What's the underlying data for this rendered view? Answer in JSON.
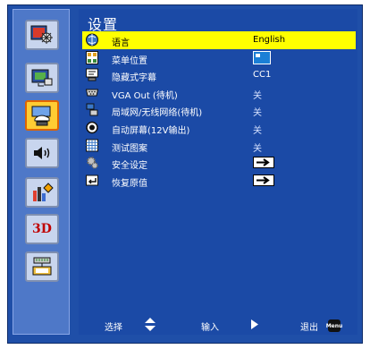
{
  "title": "设置",
  "sidebar": {
    "items": [
      {
        "icon": "image-settings-icon",
        "selected": false
      },
      {
        "icon": "display-screen-icon",
        "selected": false
      },
      {
        "icon": "setup-hand-icon",
        "selected": true
      },
      {
        "icon": "volume-icon",
        "selected": false
      },
      {
        "icon": "options-chart-icon",
        "selected": false
      },
      {
        "icon": "3d-icon",
        "label": "3D",
        "selected": false
      },
      {
        "icon": "network-lan-icon",
        "selected": false
      }
    ]
  },
  "rows": [
    {
      "label": "语言",
      "value": "English",
      "icon": "language-globe-icon",
      "selected": true
    },
    {
      "label": "菜单位置",
      "value": "",
      "icon": "menu-position-icon",
      "control": "position-box"
    },
    {
      "label": "隐藏式字幕",
      "value": "CC1",
      "icon": "closed-caption-icon"
    },
    {
      "label": "VGA Out (待机)",
      "value": "关",
      "icon": "vga-port-icon"
    },
    {
      "label": "局域网/无线网络(待机)",
      "value": "关",
      "icon": "lan-network-icon"
    },
    {
      "label": "自动屏幕(12V输出)",
      "value": "关",
      "icon": "auto-screen-icon"
    },
    {
      "label": "测试图案",
      "value": "关",
      "icon": "test-pattern-icon"
    },
    {
      "label": "安全设定",
      "value": "",
      "icon": "security-gear-icon",
      "control": "enter-arrow"
    },
    {
      "label": "恢复原值",
      "value": "",
      "icon": "reset-icon",
      "control": "enter-arrow"
    }
  ],
  "footer": {
    "select_label": "选择",
    "enter_label": "输入",
    "exit_label": "退出",
    "menu_key_label": "Menu"
  },
  "colors": {
    "frame": "#1f4fa8",
    "panel": "#1b4aa6",
    "sidebar": "#4e78c8",
    "selected_row": "#ffff00",
    "selected_tab": "#ffcc33"
  }
}
